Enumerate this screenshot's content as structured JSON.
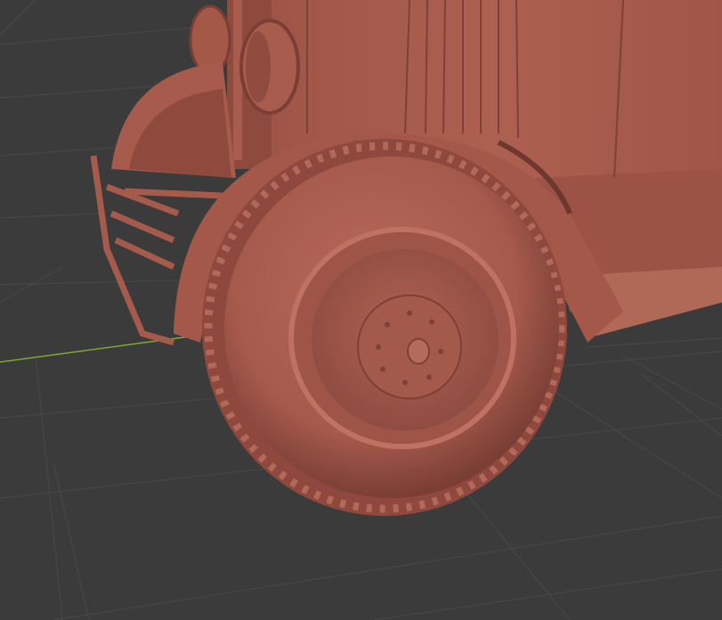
{
  "viewport": {
    "background_color": "#3b3b3b",
    "grid_color": "#474747",
    "x_axis_color": "#7fa832",
    "model_color": "#a65a4c",
    "model_shadow_color": "#6e3830",
    "model_highlight_color": "#c77b6c"
  },
  "model": {
    "parts": [
      "cab-body",
      "hood-grille",
      "headlights",
      "front-bumper",
      "front-fender",
      "front-wheel-tire",
      "wheel-rim",
      "wheel-hub",
      "running-board"
    ]
  }
}
